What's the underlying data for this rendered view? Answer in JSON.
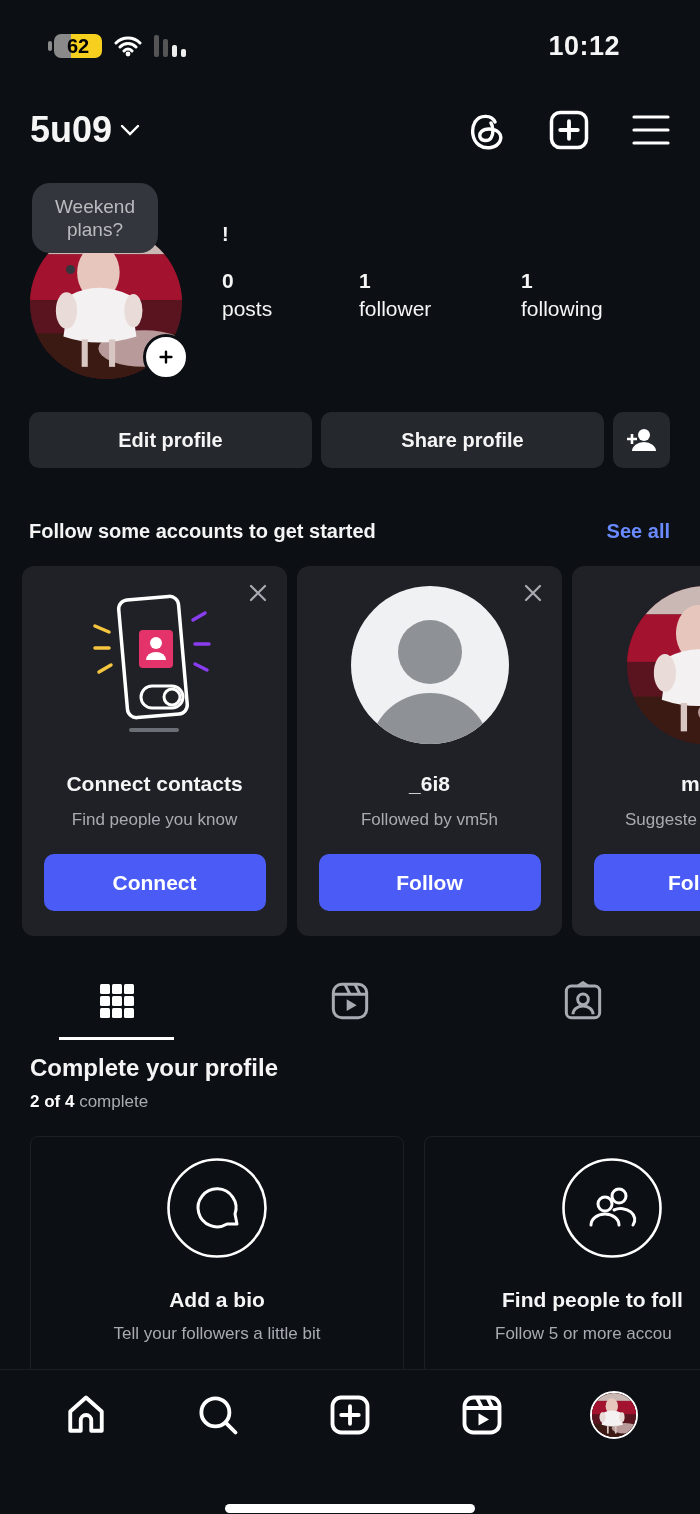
{
  "status_bar": {
    "battery": "62",
    "time": "10:12"
  },
  "header": {
    "username": "5u09"
  },
  "profile": {
    "note": "Weekend plans?",
    "name": "!",
    "stats": [
      {
        "value": "0",
        "label": "posts"
      },
      {
        "value": "1",
        "label": "follower"
      },
      {
        "value": "1",
        "label": "following"
      }
    ]
  },
  "actions": [
    "Edit profile",
    "Share profile"
  ],
  "suggestions": {
    "title": "Follow some accounts to get started",
    "see_all": "See all",
    "cards": [
      {
        "kind": "contacts",
        "title": "Connect contacts",
        "subtitle": "Find people you know",
        "button": "Connect",
        "dismissible": true
      },
      {
        "kind": "user",
        "title": "_6i8",
        "subtitle": "Followed by vm5h",
        "button": "Follow",
        "dismissible": true
      },
      {
        "kind": "picture",
        "title": "m",
        "subtitle": "Suggeste",
        "button": "Fol",
        "dismissible": false
      }
    ]
  },
  "tabs": [
    {
      "kind": "grid",
      "selected": true
    },
    {
      "kind": "reels",
      "selected": false
    },
    {
      "kind": "tagged",
      "selected": false
    }
  ],
  "complete": {
    "title": "Complete your profile",
    "progress": "**2 of 4** complete",
    "tasks": [
      {
        "kind": "bio",
        "title": "Add a bio",
        "description": "Tell your followers a little bit"
      },
      {
        "kind": "people",
        "title": "Find people to foll",
        "description": "Follow 5 or more accou"
      }
    ]
  },
  "nav": [
    {
      "kind": "home"
    },
    {
      "kind": "search"
    },
    {
      "kind": "create"
    },
    {
      "kind": "reels"
    },
    {
      "kind": "profile"
    }
  ]
}
